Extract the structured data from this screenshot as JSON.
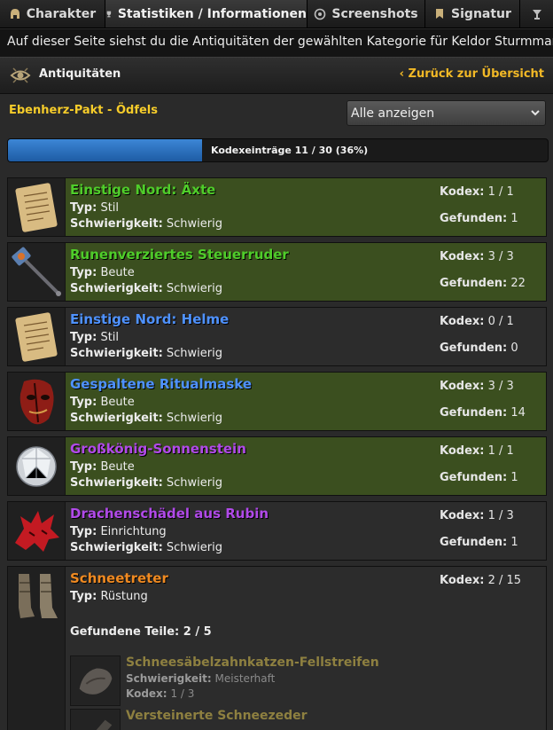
{
  "tabs": [
    {
      "label": "Charakter",
      "icon": "helmet-icon"
    },
    {
      "label": "Statistiken / Informationen",
      "icon": "trophy-icon"
    },
    {
      "label": "Screenshots",
      "icon": "camera-icon"
    },
    {
      "label": "Signatur",
      "icon": "banner-icon"
    },
    {
      "label": "",
      "icon": "goblet-icon"
    }
  ],
  "info_text": "Auf dieser Seite siehst du die Antiquitäten der gewählten Kategorie für Keldor Sturmmantel.",
  "header": {
    "title": "Antiquitäten",
    "back_label": "Zurück zur Übersicht"
  },
  "region": "Ebenherz-Pakt - Ödfels",
  "filter": {
    "selected": "Alle anzeigen"
  },
  "progress": {
    "label": "Kodexeinträge 11 / 30 (36%)",
    "percent": 36
  },
  "labels": {
    "typ": "Typ:",
    "schwierigkeit": "Schwierigkeit:",
    "kodex": "Kodex:",
    "gefunden": "Gefunden:",
    "gefundene_teile": "Gefundene Teile:"
  },
  "items": [
    {
      "name": "Einstige Nord: Äxte",
      "quality": "green",
      "complete": true,
      "icon": "scroll-icon",
      "typ": "Stil",
      "schwierigkeit": "Schwierig",
      "kodex": "1 / 1",
      "gefunden": "1"
    },
    {
      "name": "Runenverziertes Steuerruder",
      "quality": "green",
      "complete": true,
      "icon": "staff-icon",
      "typ": "Beute",
      "schwierigkeit": "Schwierig",
      "kodex": "3 / 3",
      "gefunden": "22"
    },
    {
      "name": "Einstige Nord: Helme",
      "quality": "blue",
      "complete": false,
      "icon": "scroll-icon",
      "typ": "Stil",
      "schwierigkeit": "Schwierig",
      "kodex": "0 / 1",
      "gefunden": "0"
    },
    {
      "name": "Gespaltene Ritualmaske",
      "quality": "blue",
      "complete": true,
      "icon": "mask-icon",
      "typ": "Beute",
      "schwierigkeit": "Schwierig",
      "kodex": "3 / 3",
      "gefunden": "14"
    },
    {
      "name": "Großkönig-Sonnenstein",
      "quality": "purple",
      "complete": true,
      "icon": "gem-icon",
      "typ": "Beute",
      "schwierigkeit": "Schwierig",
      "kodex": "1 / 1",
      "gefunden": "1"
    },
    {
      "name": "Drachenschädel aus Rubin",
      "quality": "purple",
      "complete": false,
      "icon": "dragon-skull-icon",
      "typ": "Einrichtung",
      "schwierigkeit": "Schwierig",
      "kodex": "1 / 3",
      "gefunden": "1"
    }
  ],
  "set_item": {
    "name": "Schneetreter",
    "quality": "orange",
    "icon": "boots-icon",
    "typ": "Rüstung",
    "kodex": "2 / 15",
    "gefundene_teile": "2 / 5",
    "parts": [
      {
        "name": "Schneesäbelzahnkatzen-Fellstreifen",
        "icon": "fur-icon",
        "schwierigkeit": "Meisterhaft",
        "kodex": "1 / 3"
      },
      {
        "name": "Versteinerte Schneezeder",
        "icon": "wood-icon",
        "schwierigkeit": "",
        "kodex": ""
      }
    ]
  }
}
